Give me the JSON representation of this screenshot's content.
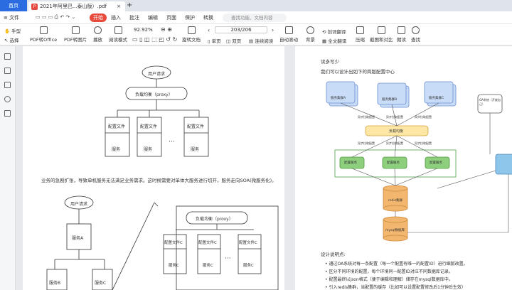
{
  "tabs": {
    "home": "首页",
    "doc": "2021年阿里巴...泰山版）.pdf",
    "close": "×",
    "add": "+"
  },
  "menu": {
    "file": "≡ 文件",
    "start": "开始",
    "insert": "插入",
    "annotate": "批注",
    "edit": "编辑",
    "page": "页面",
    "protect": "保护",
    "convert": "转换",
    "search_placeholder": "查找功能、文档内容"
  },
  "toolbar": {
    "hand": "手型",
    "select": "选择",
    "pdf_office": "PDF转Office",
    "pdf_image": "PDF转图片",
    "play": "播放",
    "read_mode": "阅读模式",
    "zoom": "92.92%",
    "rotate": "旋转文档",
    "single": "单页",
    "double": "双页",
    "continuous": "连续阅读",
    "auto_scroll": "自动滚动",
    "background": "背景",
    "translate": "划词翻译",
    "full_translate": "全文翻译",
    "compress": "压缩",
    "screenshot": "截图和对比",
    "read_aloud": "朗读",
    "find": "查找",
    "page_num": "203/206"
  },
  "page1": {
    "top_user": "用户请求",
    "top_lb": "负载均衡（proxy）",
    "config": "配置文件",
    "service": "服务",
    "dots": "···",
    "paragraph": "业务的急剧扩张，导致单机服务无法满足业务需求。这时候需要对单体大服务进行切开，服务走向SOA(微服务化)。",
    "b_user": "用户请求",
    "b_svcA": "服务A",
    "b_svcB": "服务B",
    "b_svcC": "服务C",
    "b_lb": "负载均衡（proxy）",
    "b_configC": "配置文件C",
    "b_serviceC": "服务C"
  },
  "page2": {
    "intro1": "读多写少",
    "intro2": "我们可以设计出如下的简版配置中心",
    "svcA": "服务集群A",
    "svcB": "服务集群B",
    "svcC": "服务集群C",
    "async": "异步拉取配置",
    "lb": "负载均衡",
    "cfg": "配置服务",
    "redis": "redis集群",
    "mysql": "mysql数据库",
    "oa": "OA系统（开放自己）",
    "design": "设计说明点:",
    "bullets": [
      "通过OA系统对每一条配置（每一个配置有唯一的配置ID）进行细腻改置。",
      "区分不同环境的配置，每个环境同一配置ID对应不同数据库记录。",
      "配置最终以json格式（便于编辑和理解）储存在mysql数据库中。",
      "引入redis集群，当配置的缓存（比如可以设置配置修改后1分钟后生效）"
    ]
  }
}
